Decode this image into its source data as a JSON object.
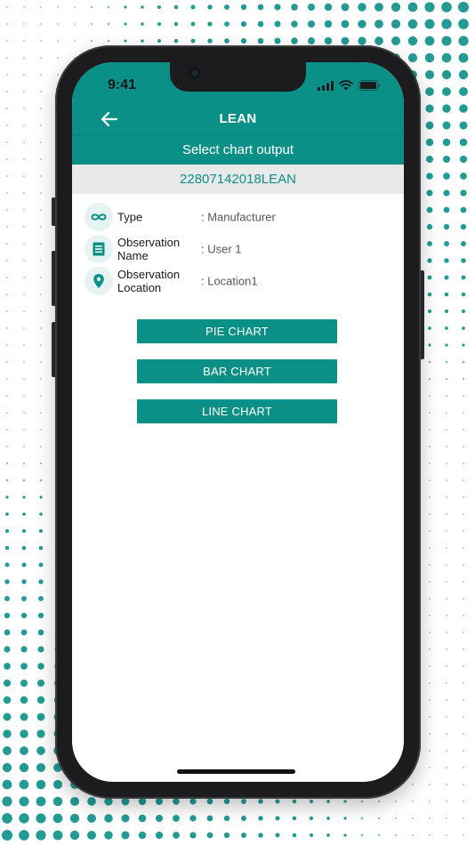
{
  "status_bar": {
    "time": "9:41"
  },
  "app_bar": {
    "title": "LEAN"
  },
  "sub_header": {
    "text": "Select chart output"
  },
  "observation_id": "22807142018LEAN",
  "details": [
    {
      "icon": "infinity-icon",
      "label": "Type",
      "value": ": Manufacturer"
    },
    {
      "icon": "document-list-icon",
      "label": "Observation Name",
      "value": ": User 1"
    },
    {
      "icon": "location-pin-icon",
      "label": "Observation Location",
      "value": ": Location1"
    }
  ],
  "buttons": {
    "pie": "PIE CHART",
    "bar": "BAR CHART",
    "line": "LINE CHART"
  },
  "colors": {
    "brand": "#0b9088",
    "icon_bg": "#e6f3f2",
    "id_bar_bg": "#e9e9e9"
  }
}
